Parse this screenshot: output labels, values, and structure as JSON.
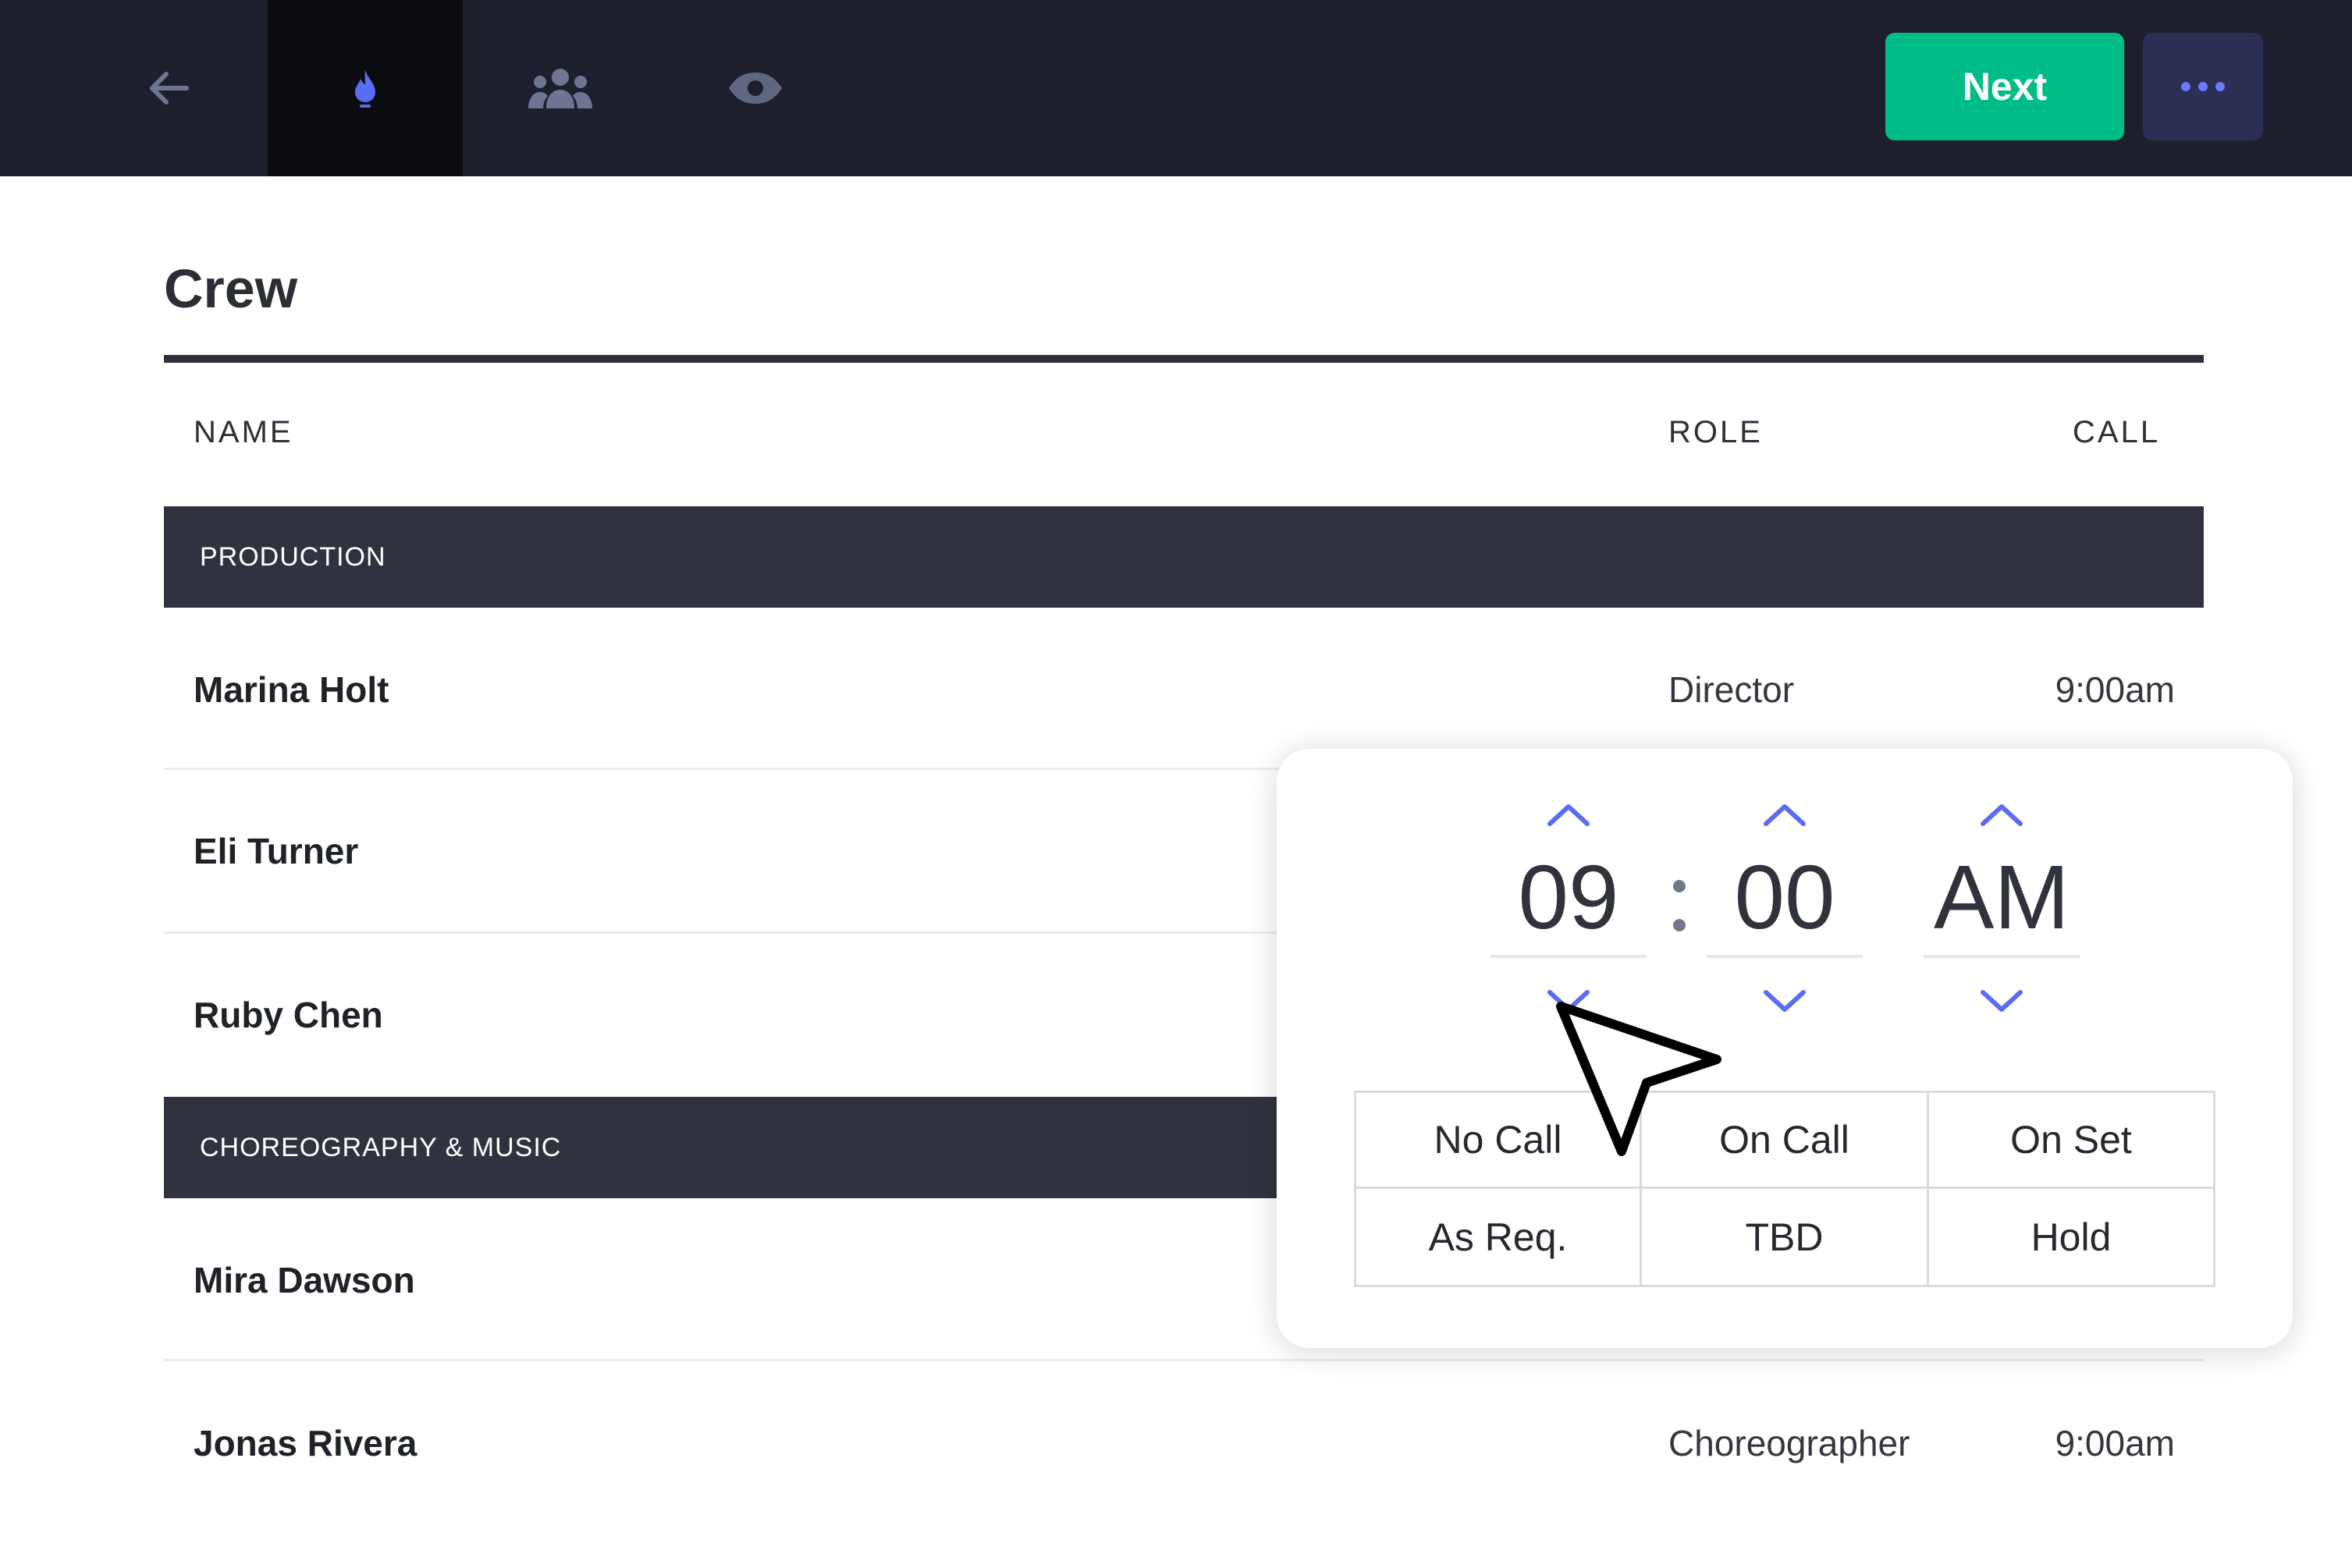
{
  "toolbar": {
    "next_label": "Next",
    "accent_color": "#5b6cf4",
    "next_color": "#00bd86",
    "nav_icons": [
      "back-arrow-icon",
      "flame-icon",
      "people-icon",
      "eye-icon"
    ]
  },
  "crew": {
    "title": "Crew",
    "columns": {
      "name": "NAME",
      "role": "ROLE",
      "call": "CALL"
    },
    "sections": [
      {
        "label": "PRODUCTION",
        "rows": [
          {
            "name": "Marina Holt",
            "role": "Director",
            "call": "9:00am"
          },
          {
            "name": "Eli Turner",
            "role": "",
            "call": ""
          },
          {
            "name": "Ruby Chen",
            "role": "",
            "call": ""
          }
        ]
      },
      {
        "label": "CHOREOGRAPHY & MUSIC",
        "rows": [
          {
            "name": "Mira Dawson",
            "role": "",
            "call": ""
          },
          {
            "name": "Jonas Rivera",
            "role": "Choreographer",
            "call": "9:00am"
          }
        ]
      }
    ]
  },
  "time_picker": {
    "hour": "09",
    "separator": ":",
    "minute": "00",
    "period": "AM",
    "options": [
      "No Call",
      "On Call",
      "On Set",
      "As Req.",
      "TBD",
      "Hold"
    ]
  }
}
